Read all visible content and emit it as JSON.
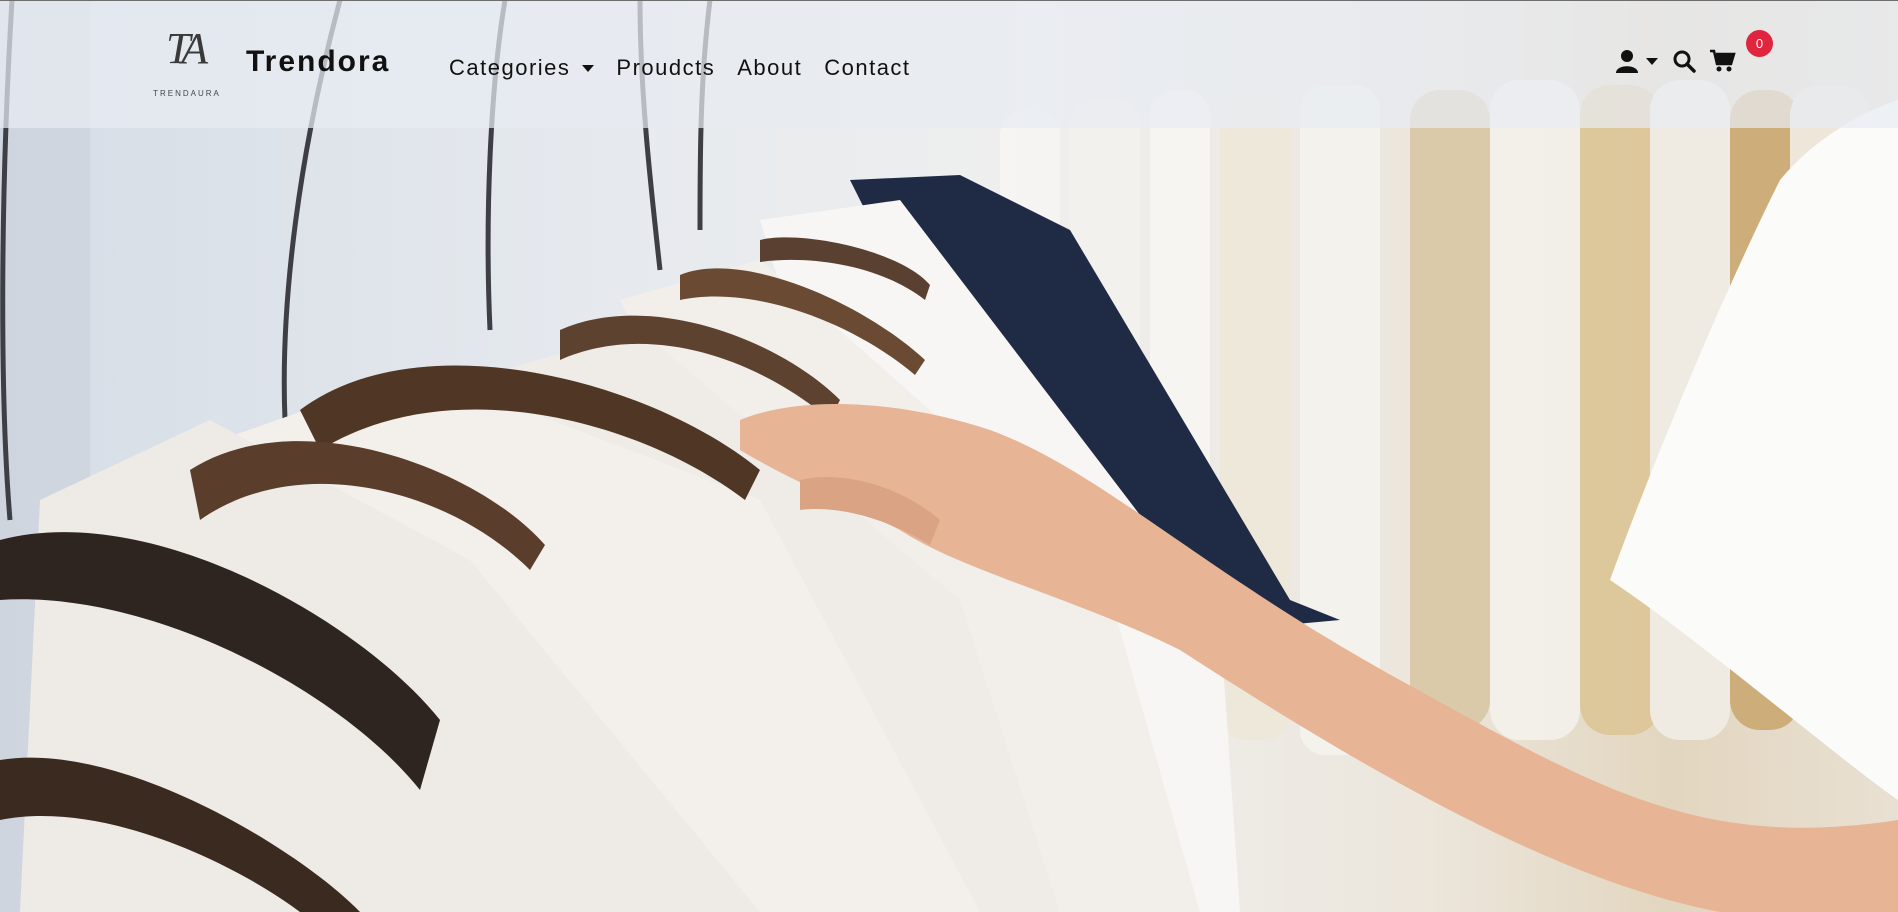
{
  "brand": {
    "logo_monogram": "TA",
    "logo_tagline": "TRENDAURA",
    "name": "Trendora"
  },
  "nav": {
    "items": [
      {
        "label": "Categories",
        "has_dropdown": true
      },
      {
        "label": "Proudcts"
      },
      {
        "label": "About"
      },
      {
        "label": "Contact"
      }
    ]
  },
  "actions": {
    "user_icon": "user-icon",
    "search_icon": "search-icon",
    "cart_icon": "cart-icon",
    "cart_count": "0"
  },
  "hero": {
    "image_subject": "shirts-on-hangers"
  },
  "colors": {
    "badge": "#e0253f",
    "text": "#111111",
    "navbar_bg": "rgba(232,236,242,0.72)"
  }
}
